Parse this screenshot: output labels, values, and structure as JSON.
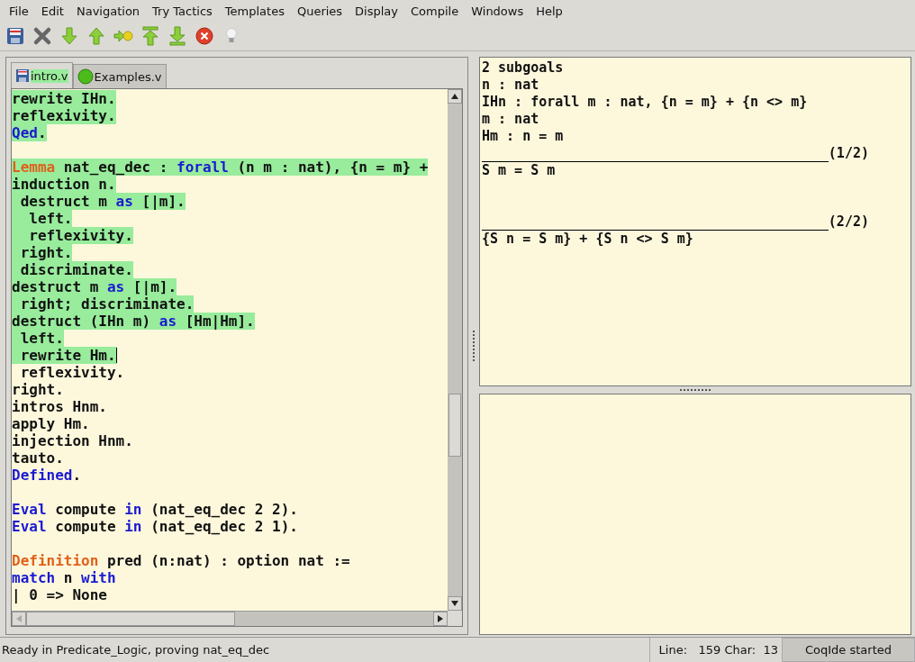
{
  "menu": [
    "File",
    "Edit",
    "Navigation",
    "Try Tactics",
    "Templates",
    "Queries",
    "Display",
    "Compile",
    "Windows",
    "Help"
  ],
  "tabs": [
    {
      "label": "intro.v",
      "selected": true,
      "modified": true
    },
    {
      "label": "Examples.v",
      "selected": false,
      "modified": false
    }
  ],
  "editor": {
    "lines": [
      {
        "kind": "code",
        "processed": true,
        "cursor": false,
        "segments": [
          {
            "kind": "text",
            "text": "rewrite IHn."
          }
        ]
      },
      {
        "kind": "code",
        "processed": true,
        "cursor": false,
        "segments": [
          {
            "kind": "text",
            "text": "reflexivity."
          }
        ]
      },
      {
        "kind": "code",
        "processed": true,
        "cursor": false,
        "segments": [
          {
            "kind": "keyword",
            "text": "Qed"
          },
          {
            "kind": "text",
            "text": "."
          }
        ]
      },
      {
        "kind": "blank"
      },
      {
        "kind": "code",
        "processed": true,
        "cursor": false,
        "segments": [
          {
            "kind": "decl",
            "text": "Lemma"
          },
          {
            "kind": "text",
            "text": " nat_eq_dec : "
          },
          {
            "kind": "keyword",
            "text": "forall"
          },
          {
            "kind": "text",
            "text": " (n m : nat), {n = m} +"
          }
        ]
      },
      {
        "kind": "code",
        "processed": true,
        "cursor": false,
        "segments": [
          {
            "kind": "text",
            "text": "induction n."
          }
        ]
      },
      {
        "kind": "code",
        "processed": true,
        "cursor": false,
        "segments": [
          {
            "kind": "text",
            "text": " destruct m "
          },
          {
            "kind": "keyword",
            "text": "as"
          },
          {
            "kind": "text",
            "text": " [|m]."
          }
        ]
      },
      {
        "kind": "code",
        "processed": true,
        "cursor": false,
        "segments": [
          {
            "kind": "text",
            "text": "  left."
          }
        ]
      },
      {
        "kind": "code",
        "processed": true,
        "cursor": false,
        "segments": [
          {
            "kind": "text",
            "text": "  reflexivity."
          }
        ]
      },
      {
        "kind": "code",
        "processed": true,
        "cursor": false,
        "segments": [
          {
            "kind": "text",
            "text": " right."
          }
        ]
      },
      {
        "kind": "code",
        "processed": true,
        "cursor": false,
        "segments": [
          {
            "kind": "text",
            "text": " discriminate."
          }
        ]
      },
      {
        "kind": "code",
        "processed": true,
        "cursor": false,
        "segments": [
          {
            "kind": "text",
            "text": "destruct m "
          },
          {
            "kind": "keyword",
            "text": "as"
          },
          {
            "kind": "text",
            "text": " [|m]."
          }
        ]
      },
      {
        "kind": "code",
        "processed": true,
        "cursor": false,
        "segments": [
          {
            "kind": "text",
            "text": " right; discriminate."
          }
        ]
      },
      {
        "kind": "code",
        "processed": true,
        "cursor": false,
        "segments": [
          {
            "kind": "text",
            "text": "destruct (IHn m) "
          },
          {
            "kind": "keyword",
            "text": "as"
          },
          {
            "kind": "text",
            "text": " [Hm|Hm]."
          }
        ]
      },
      {
        "kind": "code",
        "processed": true,
        "cursor": false,
        "segments": [
          {
            "kind": "text",
            "text": " left."
          }
        ]
      },
      {
        "kind": "code",
        "processed": true,
        "cursor": true,
        "segments": [
          {
            "kind": "text",
            "text": " rewrite Hm."
          }
        ]
      },
      {
        "kind": "code",
        "processed": false,
        "cursor": false,
        "segments": [
          {
            "kind": "text",
            "text": " reflexivity."
          }
        ]
      },
      {
        "kind": "code",
        "processed": false,
        "cursor": false,
        "segments": [
          {
            "kind": "text",
            "text": "right."
          }
        ]
      },
      {
        "kind": "code",
        "processed": false,
        "cursor": false,
        "segments": [
          {
            "kind": "text",
            "text": "intros Hnm."
          }
        ]
      },
      {
        "kind": "code",
        "processed": false,
        "cursor": false,
        "segments": [
          {
            "kind": "text",
            "text": "apply Hm."
          }
        ]
      },
      {
        "kind": "code",
        "processed": false,
        "cursor": false,
        "segments": [
          {
            "kind": "text",
            "text": "injection Hnm."
          }
        ]
      },
      {
        "kind": "code",
        "processed": false,
        "cursor": false,
        "segments": [
          {
            "kind": "text",
            "text": "tauto."
          }
        ]
      },
      {
        "kind": "code",
        "processed": false,
        "cursor": false,
        "segments": [
          {
            "kind": "keyword",
            "text": "Defined"
          },
          {
            "kind": "text",
            "text": "."
          }
        ]
      },
      {
        "kind": "blank"
      },
      {
        "kind": "code",
        "processed": false,
        "cursor": false,
        "segments": [
          {
            "kind": "keyword",
            "text": "Eval"
          },
          {
            "kind": "text",
            "text": " compute "
          },
          {
            "kind": "keyword",
            "text": "in"
          },
          {
            "kind": "text",
            "text": " (nat_eq_dec 2 2)."
          }
        ]
      },
      {
        "kind": "code",
        "processed": false,
        "cursor": false,
        "segments": [
          {
            "kind": "keyword",
            "text": "Eval"
          },
          {
            "kind": "text",
            "text": " compute "
          },
          {
            "kind": "keyword",
            "text": "in"
          },
          {
            "kind": "text",
            "text": " (nat_eq_dec 2 1)."
          }
        ]
      },
      {
        "kind": "blank"
      },
      {
        "kind": "code",
        "processed": false,
        "cursor": false,
        "segments": [
          {
            "kind": "decl",
            "text": "Definition"
          },
          {
            "kind": "text",
            "text": " pred (n:nat) : option nat :="
          }
        ]
      },
      {
        "kind": "code",
        "processed": false,
        "cursor": false,
        "segments": [
          {
            "kind": "keyword",
            "text": "match"
          },
          {
            "kind": "text",
            "text": " n "
          },
          {
            "kind": "keyword",
            "text": "with"
          }
        ]
      },
      {
        "kind": "code",
        "processed": false,
        "cursor": false,
        "segments": [
          {
            "kind": "text",
            "text": "| 0 => None"
          }
        ]
      }
    ]
  },
  "goals": {
    "summary": "2 subgoals",
    "hypotheses": [
      "n : nat",
      "IHn : forall m : nat, {n = m} + {n <> m}",
      "m : nat",
      "Hm : n = m"
    ],
    "subgoals": [
      {
        "label": "(1/2)",
        "conclusion": "S m = S m"
      },
      {
        "label": "(2/2)",
        "conclusion": "{S n = S m} + {S n <> S m}"
      }
    ]
  },
  "status_bar": {
    "message": "Ready in Predicate_Logic, proving nat_eq_dec",
    "position": "Line:   159 Char:  13",
    "notice": "CoqIde started"
  }
}
